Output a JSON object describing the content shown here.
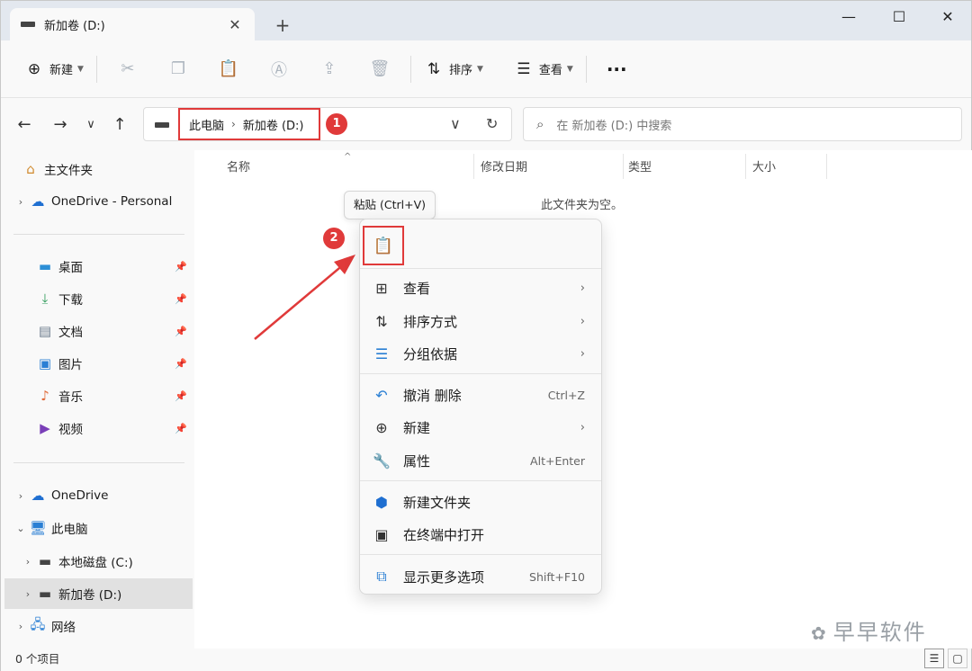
{
  "tab": {
    "title": "新加卷 (D:)"
  },
  "commandbar": {
    "new_label": "新建",
    "sort_label": "排序",
    "view_label": "查看"
  },
  "address": {
    "crumbs": [
      "此电脑",
      "新加卷 (D:)"
    ],
    "search_placeholder": "在 新加卷 (D:) 中搜索"
  },
  "badges": {
    "one": "1",
    "two": "2"
  },
  "sidebar": {
    "home": "主文件夹",
    "onedrive_personal": "OneDrive - Personal",
    "quick": [
      "桌面",
      "下载",
      "文档",
      "图片",
      "音乐",
      "视频"
    ],
    "onedrive": "OneDrive",
    "this_pc": "此电脑",
    "drive_c": "本地磁盘 (C:)",
    "drive_d": "新加卷 (D:)",
    "network": "网络"
  },
  "columns": {
    "name": "名称",
    "modified": "修改日期",
    "type": "类型",
    "size": "大小"
  },
  "content": {
    "empty_message": "此文件夹为空。"
  },
  "tooltip": {
    "paste": "粘贴 (Ctrl+V)"
  },
  "context_menu": {
    "view": "查看",
    "sort": "排序方式",
    "group": "分组依据",
    "undo": "撤消 删除",
    "undo_shortcut": "Ctrl+Z",
    "new": "新建",
    "properties": "属性",
    "properties_shortcut": "Alt+Enter",
    "new_folder": "新建文件夹",
    "open_terminal": "在终端中打开",
    "more_options": "显示更多选项",
    "more_options_shortcut": "Shift+F10"
  },
  "status": {
    "items": "0 个项目"
  },
  "watermark": {
    "text": "早早软件"
  },
  "colors": {
    "accent_red": "#e03a3a",
    "accent_blue": "#3b6fb6"
  }
}
